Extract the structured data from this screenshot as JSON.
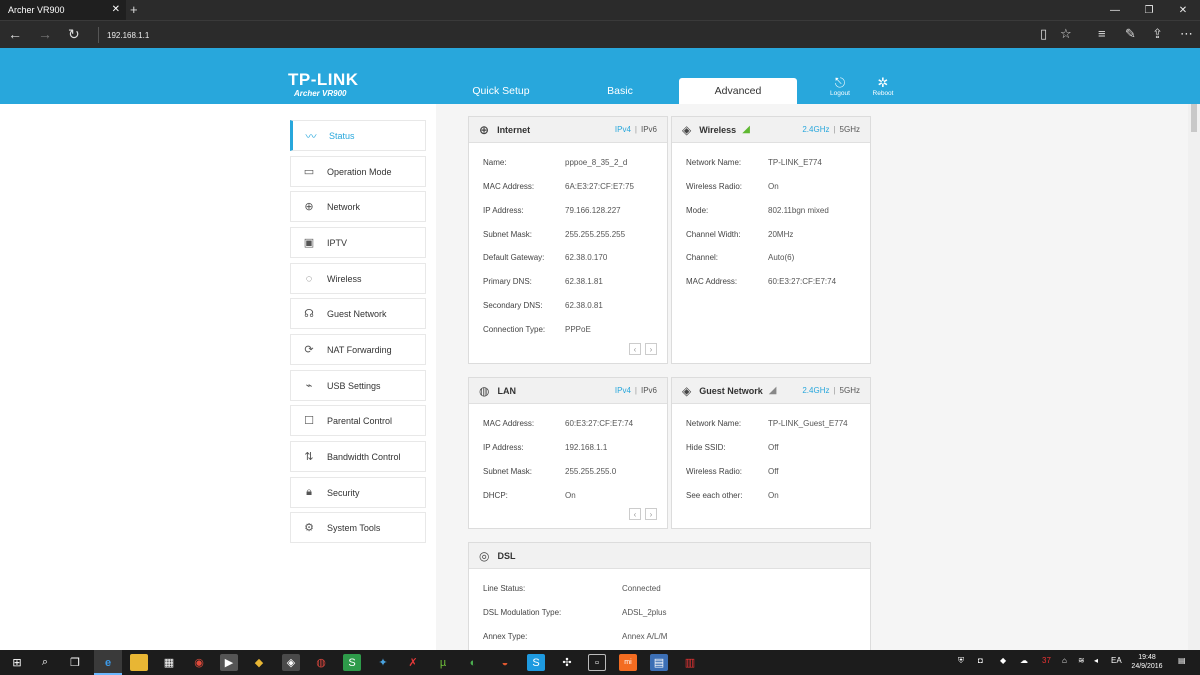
{
  "browser": {
    "tab_title": "Archer VR900",
    "tab_close": "✕",
    "new_tab": "+",
    "win_min": "—",
    "win_max": "❐",
    "win_close": "✕",
    "address": "192.168.1.1"
  },
  "header": {
    "brand": "TP-LINK",
    "model": "Archer VR900",
    "tabs": [
      "Quick Setup",
      "Basic",
      "Advanced"
    ],
    "logout": "Logout",
    "reboot": "Reboot",
    "accent": "#28a7dc"
  },
  "sidebar": {
    "items": [
      {
        "label": "Status",
        "icon": "activity-icon"
      },
      {
        "label": "Operation Mode",
        "icon": "monitor-icon"
      },
      {
        "label": "Network",
        "icon": "globe-icon"
      },
      {
        "label": "IPTV",
        "icon": "tv-icon"
      },
      {
        "label": "Wireless",
        "icon": "wireless-icon"
      },
      {
        "label": "Guest Network",
        "icon": "users-icon"
      },
      {
        "label": "NAT Forwarding",
        "icon": "refresh-icon"
      },
      {
        "label": "USB Settings",
        "icon": "usb-icon"
      },
      {
        "label": "Parental Control",
        "icon": "parental-icon"
      },
      {
        "label": "Bandwidth Control",
        "icon": "bandwidth-icon"
      },
      {
        "label": "Security",
        "icon": "lock-icon"
      },
      {
        "label": "System Tools",
        "icon": "gear-icon"
      }
    ]
  },
  "internet": {
    "title": "Internet",
    "toggle": [
      "IPv4",
      "IPv6"
    ],
    "sep": "|",
    "rows": [
      {
        "label": "Name:",
        "value": "pppoe_8_35_2_d"
      },
      {
        "label": "MAC Address:",
        "value": "6A:E3:27:CF:E7:75"
      },
      {
        "label": "IP Address:",
        "value": "79.166.128.227"
      },
      {
        "label": "Subnet Mask:",
        "value": "255.255.255.255"
      },
      {
        "label": "Default Gateway:",
        "value": "62.38.0.170"
      },
      {
        "label": "Primary DNS:",
        "value": "62.38.1.81"
      },
      {
        "label": "Secondary DNS:",
        "value": "62.38.0.81"
      },
      {
        "label": "Connection Type:",
        "value": "PPPoE"
      }
    ]
  },
  "wireless": {
    "title": "Wireless",
    "toggle": [
      "2.4GHz",
      "5GHz"
    ],
    "sep": "|",
    "rows": [
      {
        "label": "Network Name:",
        "value": "TP-LINK_E774"
      },
      {
        "label": "Wireless Radio:",
        "value": "On"
      },
      {
        "label": "Mode:",
        "value": "802.11bgn mixed"
      },
      {
        "label": "Channel Width:",
        "value": "20MHz"
      },
      {
        "label": "Channel:",
        "value": "Auto(6)"
      },
      {
        "label": "MAC Address:",
        "value": "60:E3:27:CF:E7:74"
      }
    ]
  },
  "lan": {
    "title": "LAN",
    "toggle": [
      "IPv4",
      "IPv6"
    ],
    "sep": "|",
    "rows": [
      {
        "label": "MAC Address:",
        "value": "60:E3:27:CF:E7:74"
      },
      {
        "label": "IP Address:",
        "value": "192.168.1.1"
      },
      {
        "label": "Subnet Mask:",
        "value": "255.255.255.0"
      },
      {
        "label": "DHCP:",
        "value": "On"
      }
    ]
  },
  "guest": {
    "title": "Guest Network",
    "toggle": [
      "2.4GHz",
      "5GHz"
    ],
    "sep": "|",
    "rows": [
      {
        "label": "Network Name:",
        "value": "TP-LINK_Guest_E774"
      },
      {
        "label": "Hide SSID:",
        "value": "Off"
      },
      {
        "label": "Wireless Radio:",
        "value": "Off"
      },
      {
        "label": "See each other:",
        "value": "On"
      }
    ]
  },
  "dsl": {
    "title": "DSL",
    "rows": [
      {
        "label": "Line Status:",
        "value": "Connected"
      },
      {
        "label": "DSL Modulation Type:",
        "value": "ADSL_2plus"
      },
      {
        "label": "Annex Type:",
        "value": "Annex A/L/M"
      }
    ]
  },
  "pager": {
    "prev": "‹",
    "next": "›"
  },
  "taskbar": {
    "language": "EA",
    "time": "19:48",
    "date": "24/9/2016",
    "badge": "37"
  }
}
